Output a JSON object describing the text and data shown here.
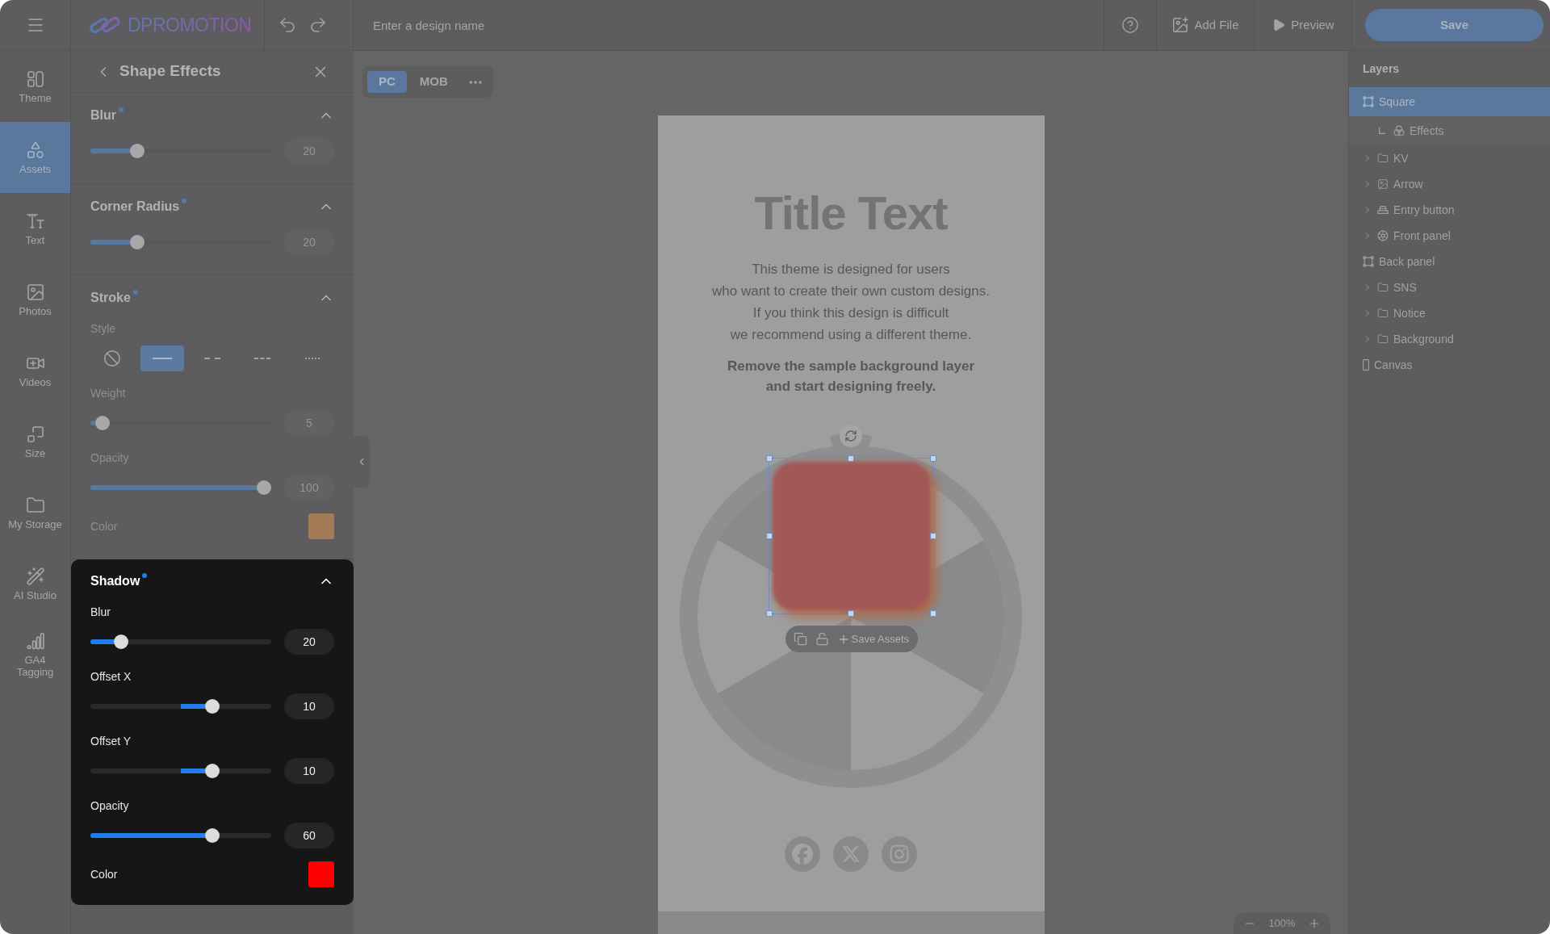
{
  "top_bar": {
    "logo": "DPROMOTION",
    "design_name": {
      "placeholder": "Enter a design name"
    },
    "add_file": "Add File",
    "preview": "Preview",
    "save": "Save"
  },
  "sidebar": {
    "items": [
      {
        "label": "Theme",
        "selected": false
      },
      {
        "label": "Assets",
        "selected": true
      },
      {
        "label": "Text",
        "selected": false
      },
      {
        "label": "Photos",
        "selected": false
      },
      {
        "label": "Videos",
        "selected": false
      },
      {
        "label": "Size",
        "selected": false
      },
      {
        "label": "My Storage",
        "selected": false
      },
      {
        "label": "AI Studio",
        "selected": false
      },
      {
        "label": "GA4 Tagging",
        "selected": false
      }
    ]
  },
  "effects_panel": {
    "title": "Shape Effects",
    "sections": [
      {
        "title": "Blur",
        "modified": true,
        "expanded": true,
        "highlighted": false,
        "rows": [
          {
            "kind": "slider",
            "level": 0.24,
            "value": "20"
          }
        ]
      },
      {
        "title": "Corner Radius",
        "modified": true,
        "expanded": true,
        "highlighted": false,
        "rows": [
          {
            "kind": "slider",
            "level": 0.24,
            "value": "20"
          }
        ]
      },
      {
        "title": "Stroke",
        "modified": true,
        "expanded": true,
        "highlighted": false,
        "rows": [
          {
            "kind": "styles",
            "label": "Style",
            "options": [
              {
                "kind": "none",
                "selected": false
              },
              {
                "kind": "solid",
                "selected": true
              },
              {
                "kind": "long_dash",
                "selected": false
              },
              {
                "kind": "short_dash",
                "selected": false
              },
              {
                "kind": "dotted",
                "selected": false
              }
            ]
          },
          {
            "kind": "slider",
            "label": "Weight",
            "level": 0.03,
            "value": "5"
          },
          {
            "kind": "slider",
            "label": "Opacity",
            "level": 1,
            "value": "100"
          },
          {
            "kind": "color",
            "label": "Color",
            "color": "#a47b57"
          }
        ]
      },
      {
        "title": "Shadow",
        "modified": true,
        "expanded": true,
        "highlighted": true,
        "rows": [
          {
            "kind": "slider",
            "label": "Blur",
            "level": 0.14,
            "value": "20"
          },
          {
            "kind": "centered_slider",
            "label": "Offset X",
            "level": 0.69,
            "value": "10"
          },
          {
            "kind": "centered_slider",
            "label": "Offset Y",
            "level": 0.69,
            "value": "10"
          },
          {
            "kind": "slider",
            "label": "Opacity",
            "level": 0.69,
            "value": "60"
          },
          {
            "kind": "color",
            "label": "Color",
            "color": "#ff0000"
          }
        ]
      }
    ]
  },
  "canvas": {
    "device_tabs": [
      {
        "label": "PC",
        "selected": true
      },
      {
        "label": "MOB",
        "selected": false
      }
    ],
    "page": {
      "title": "Title Text",
      "description": "This theme is designed for users\nwho want to create their own custom designs.\nIf you think this design is difficult\nwe recommend using a different theme.",
      "note": "Remove the sample background layer\nand start designing freely."
    },
    "selection_toolbar": {
      "save_assets": "Save Assets"
    },
    "zoom": "100%"
  },
  "layers_panel": {
    "title": "Layers",
    "items": [
      {
        "label": "Square",
        "kind": "shape",
        "selected": true,
        "children": [
          {
            "label": "Effects",
            "kind": "effects",
            "selected": false
          }
        ]
      },
      {
        "label": "KV",
        "kind": "group",
        "selected": false,
        "expanded": false
      },
      {
        "label": "Arrow",
        "kind": "image",
        "selected": false,
        "expanded": false
      },
      {
        "label": "Entry button",
        "kind": "button",
        "selected": false,
        "expanded": false
      },
      {
        "label": "Front panel",
        "kind": "wheel",
        "selected": false,
        "expanded": false
      },
      {
        "label": "Back panel",
        "kind": "shape",
        "selected": false
      },
      {
        "label": "SNS",
        "kind": "group",
        "selected": false,
        "expanded": false
      },
      {
        "label": "Notice",
        "kind": "group",
        "selected": false,
        "expanded": false
      },
      {
        "label": "Background",
        "kind": "group",
        "selected": false,
        "expanded": false
      },
      {
        "label": "Canvas",
        "kind": "page",
        "selected": false
      }
    ]
  }
}
